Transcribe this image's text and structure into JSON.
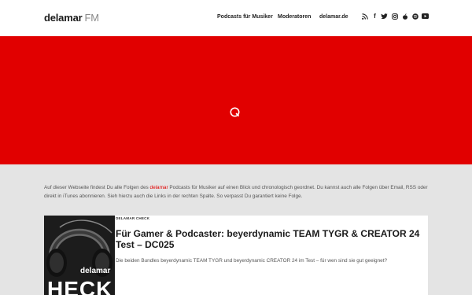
{
  "header": {
    "logo_brand": "delamar",
    "logo_suffix": "FM",
    "nav": [
      "Podcasts für Musiker",
      "Moderatoren",
      "delamar.de"
    ],
    "social_icons": [
      "rss-icon",
      "facebook-icon",
      "twitter-icon",
      "instagram-icon",
      "apple-icon",
      "spotify-icon",
      "youtube-icon"
    ]
  },
  "colors": {
    "accent": "#e10000",
    "background": "#e4e4e4",
    "header_bg": "#ffffff"
  },
  "intro": {
    "before": "Auf dieser Webseite findest Du alle Folgen des ",
    "highlight": "delamar",
    "after": " Podcasts für Musiker auf einen Blick und chronologisch geordnet. Du kannst auch alle Folgen über Email, RSS oder direkt in iTunes abonnieren. Sieh hierzu auch die Links in der rechten Spalte. So verpasst Du garantiert keine Folge."
  },
  "episode": {
    "category": "DELAMAR CHECK",
    "title": "Für Gamer & Podcaster: beyerdynamic TEAM TYGR & CREATOR 24 Test – DC025",
    "description": "Die beiden Bundles beyerdynamic TEAM TYGR und beyerdynamic CREATOR 24 im Test – für wen sind sie gut geeignet?",
    "thumb_logo": "delamar",
    "thumb_big": "HECK"
  }
}
